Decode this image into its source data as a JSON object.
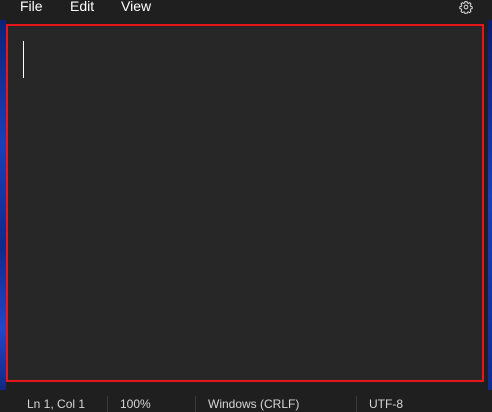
{
  "menubar": {
    "items": [
      {
        "label": "File"
      },
      {
        "label": "Edit"
      },
      {
        "label": "View"
      }
    ],
    "settings_icon": "gear-icon"
  },
  "editor": {
    "content": "",
    "highlight_color": "#e8151b",
    "background": "#272727"
  },
  "statusbar": {
    "position": "Ln 1, Col 1",
    "zoom": "100%",
    "line_ending": "Windows (CRLF)",
    "encoding": "UTF-8"
  }
}
